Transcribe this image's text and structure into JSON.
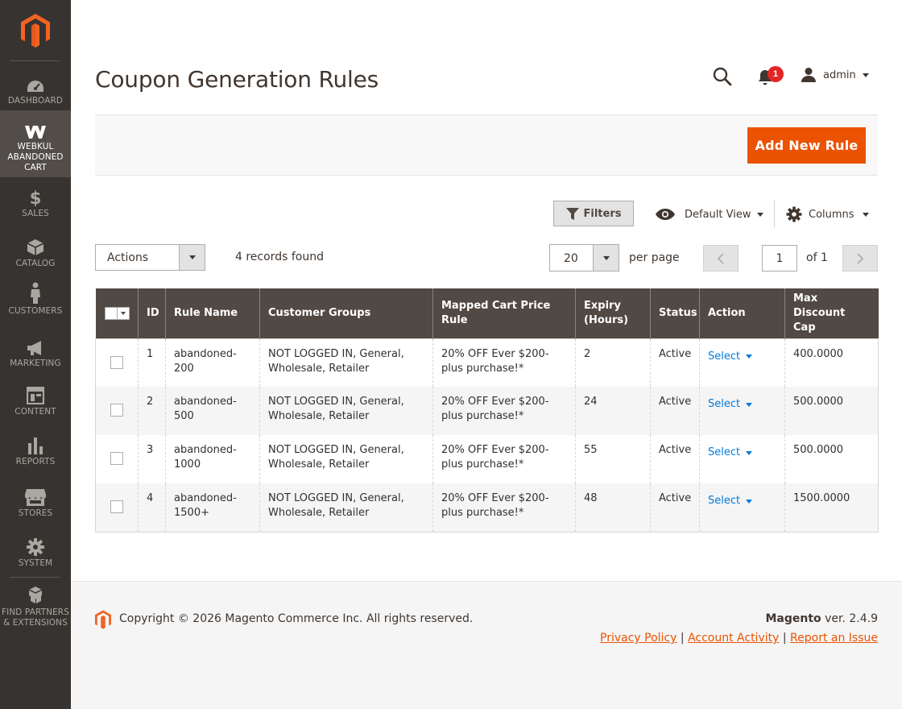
{
  "sidebar": {
    "items": [
      {
        "label": "DASHBOARD",
        "icon": "dashboard-icon"
      },
      {
        "label": "WEBKUL ABANDONED CART",
        "icon": "webkul-icon"
      },
      {
        "label": "SALES",
        "icon": "dollar-icon"
      },
      {
        "label": "CATALOG",
        "icon": "catalog-box-icon"
      },
      {
        "label": "CUSTOMERS",
        "icon": "person-icon"
      },
      {
        "label": "MARKETING",
        "icon": "megaphone-icon"
      },
      {
        "label": "CONTENT",
        "icon": "content-layout-icon"
      },
      {
        "label": "REPORTS",
        "icon": "bar-chart-icon"
      },
      {
        "label": "STORES",
        "icon": "storefront-icon"
      },
      {
        "label": "SYSTEM",
        "icon": "gear-icon"
      },
      {
        "label": "FIND PARTNERS & EXTENSIONS",
        "icon": "cubes-icon"
      }
    ]
  },
  "header": {
    "title": "Coupon Generation Rules",
    "notifications_count": "1",
    "user_name": "admin"
  },
  "action_bar": {
    "add_label": "Add New Rule"
  },
  "toolbar": {
    "filters_label": "Filters",
    "view_label": "Default View",
    "columns_label": "Columns",
    "actions_label": "Actions",
    "records_found": "4 records found",
    "per_page_value": "20",
    "per_page_label": "per page",
    "page_value": "1",
    "page_of": "of 1"
  },
  "grid": {
    "columns": [
      "ID",
      "Rule Name",
      "Customer Groups",
      "Mapped Cart Price Rule",
      "Expiry (Hours)",
      "Status",
      "Action",
      "Max Discount Cap"
    ],
    "rows": [
      {
        "id": "1",
        "name": "abandoned-200",
        "groups": "NOT LOGGED IN, General, Wholesale, Retailer",
        "mapped": "20% OFF Ever $200-plus purchase!*",
        "expiry": "2",
        "status": "Active",
        "action": "Select",
        "cap": "400.0000"
      },
      {
        "id": "2",
        "name": "abandoned-500",
        "groups": "NOT LOGGED IN, General, Wholesale, Retailer",
        "mapped": "20% OFF Ever $200-plus purchase!*",
        "expiry": "24",
        "status": "Active",
        "action": "Select",
        "cap": "500.0000"
      },
      {
        "id": "3",
        "name": "abandoned-1000",
        "groups": "NOT LOGGED IN, General, Wholesale, Retailer",
        "mapped": "20% OFF Ever $200-plus purchase!*",
        "expiry": "55",
        "status": "Active",
        "action": "Select",
        "cap": "500.0000"
      },
      {
        "id": "4",
        "name": "abandoned-1500+",
        "groups": "NOT LOGGED IN, General, Wholesale, Retailer",
        "mapped": "20% OFF Ever $200-plus purchase!*",
        "expiry": "48",
        "status": "Active",
        "action": "Select",
        "cap": "1500.0000"
      }
    ]
  },
  "footer": {
    "copyright": "Copyright © 2026 Magento Commerce Inc. All rights reserved.",
    "brand": "Magento",
    "version": " ver. 2.4.9",
    "links": [
      "Privacy Policy",
      "Account Activity",
      "Report an Issue"
    ],
    "separator": "|"
  },
  "colors": {
    "sidebar_bg": "#373330",
    "accent": "#eb5202",
    "grid_header": "#514943",
    "link": "#007bdb",
    "badge": "#e22626"
  }
}
